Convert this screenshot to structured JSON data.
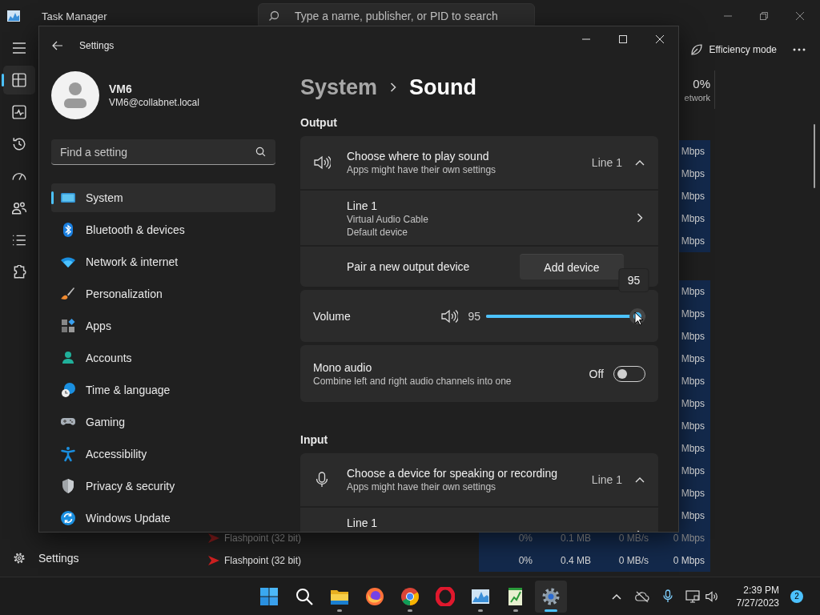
{
  "task_manager": {
    "title": "Task Manager",
    "search": {
      "placeholder": "Type a name, publisher, or PID to search"
    },
    "nav": [
      {
        "kind": "processes",
        "selected": true
      },
      {
        "kind": "performance",
        "selected": false
      },
      {
        "kind": "history",
        "selected": false
      },
      {
        "kind": "startup",
        "selected": false
      },
      {
        "kind": "users",
        "selected": false
      },
      {
        "kind": "details",
        "selected": false
      },
      {
        "kind": "services",
        "selected": false
      }
    ],
    "footer": {
      "label": "Settings"
    },
    "toolbar": {
      "efficiency_label": "Efficiency mode"
    },
    "network_header": {
      "value": "0%",
      "label": "etwork"
    },
    "groups": [
      {
        "rows": [
          {
            "network": "Mbps"
          },
          {
            "network": "Mbps"
          },
          {
            "network": "Mbps"
          },
          {
            "network": "Mbps"
          },
          {
            "network": "Mbps"
          }
        ]
      },
      {
        "rows": [
          {
            "network": "Mbps"
          },
          {
            "network": "Mbps"
          },
          {
            "network": "Mbps"
          },
          {
            "network": "Mbps"
          },
          {
            "network": "Mbps"
          },
          {
            "network": "Mbps"
          },
          {
            "network": "Mbps"
          },
          {
            "network": "Mbps"
          },
          {
            "network": "Mbps"
          },
          {
            "network": "Mbps"
          },
          {
            "network": "Mbps"
          },
          {
            "name": "Flashpoint (32 bit)",
            "dimmed": true,
            "cpu": "0%",
            "memory": "0.1 MB",
            "disk": "0 MB/s",
            "network": "0 Mbps"
          },
          {
            "name": "Flashpoint (32 bit)",
            "dimmed": false,
            "cpu": "0%",
            "memory": "0.4 MB",
            "disk": "0 MB/s",
            "network": "0 Mbps"
          }
        ]
      }
    ]
  },
  "settings": {
    "title": "Settings",
    "user": {
      "name": "VM6",
      "email": "VM6@collabnet.local"
    },
    "search": {
      "placeholder": "Find a setting"
    },
    "nav": [
      {
        "label": "System",
        "kind": "system",
        "selected": true
      },
      {
        "label": "Bluetooth & devices",
        "kind": "bluetooth",
        "selected": false
      },
      {
        "label": "Network & internet",
        "kind": "network",
        "selected": false
      },
      {
        "label": "Personalization",
        "kind": "personalization",
        "selected": false
      },
      {
        "label": "Apps",
        "kind": "apps",
        "selected": false
      },
      {
        "label": "Accounts",
        "kind": "accounts",
        "selected": false
      },
      {
        "label": "Time & language",
        "kind": "time",
        "selected": false
      },
      {
        "label": "Gaming",
        "kind": "gaming",
        "selected": false
      },
      {
        "label": "Accessibility",
        "kind": "accessibility",
        "selected": false
      },
      {
        "label": "Privacy & security",
        "kind": "privacy",
        "selected": false
      },
      {
        "label": "Windows Update",
        "kind": "update",
        "selected": false
      }
    ],
    "breadcrumb": {
      "parent": "System",
      "current": "Sound"
    },
    "sections": [
      {
        "heading": "Output",
        "kind": "output",
        "cards": [
          {
            "rows": [
              {
                "kind": "selector",
                "title": "Choose where to play sound",
                "subtitle": "Apps might have their own settings",
                "value": "Line 1",
                "expanded": true
              },
              {
                "kind": "device",
                "name": "Line 1",
                "lines": [
                  "Virtual Audio Cable",
                  "Default device"
                ]
              },
              {
                "kind": "pair",
                "label": "Pair a new output device",
                "button": "Add device"
              }
            ]
          },
          {
            "rows": [
              {
                "kind": "volume",
                "label": "Volume",
                "reading": "95",
                "level": 0.95,
                "tooltip": "95"
              }
            ]
          },
          {
            "rows": [
              {
                "kind": "toggle",
                "title": "Mono audio",
                "subtitle": "Combine left and right audio channels into one",
                "state_label": "Off",
                "on": false
              }
            ]
          }
        ]
      },
      {
        "heading": "Input",
        "kind": "input",
        "cards": [
          {
            "rows": [
              {
                "kind": "selector",
                "title": "Choose a device for speaking or recording",
                "subtitle": "Apps might have their own settings",
                "value": "Line 1",
                "expanded": true
              },
              {
                "kind": "device",
                "name": "Line 1"
              }
            ]
          }
        ]
      }
    ]
  },
  "taskbar": {
    "apps": [
      {
        "kind": "start",
        "running": false,
        "active": false
      },
      {
        "kind": "search",
        "running": false,
        "active": false
      },
      {
        "kind": "explorer",
        "running": true,
        "active": false
      },
      {
        "kind": "firefox",
        "running": false,
        "active": false
      },
      {
        "kind": "chrome",
        "running": true,
        "active": false
      },
      {
        "kind": "opera",
        "running": false,
        "active": false
      },
      {
        "kind": "monitor",
        "running": true,
        "active": false
      },
      {
        "kind": "notepad",
        "running": true,
        "active": false
      },
      {
        "kind": "settings",
        "running": true,
        "active": true
      }
    ],
    "clock": {
      "time": "2:39 PM",
      "date": "7/27/2023"
    },
    "notifications": "2"
  }
}
